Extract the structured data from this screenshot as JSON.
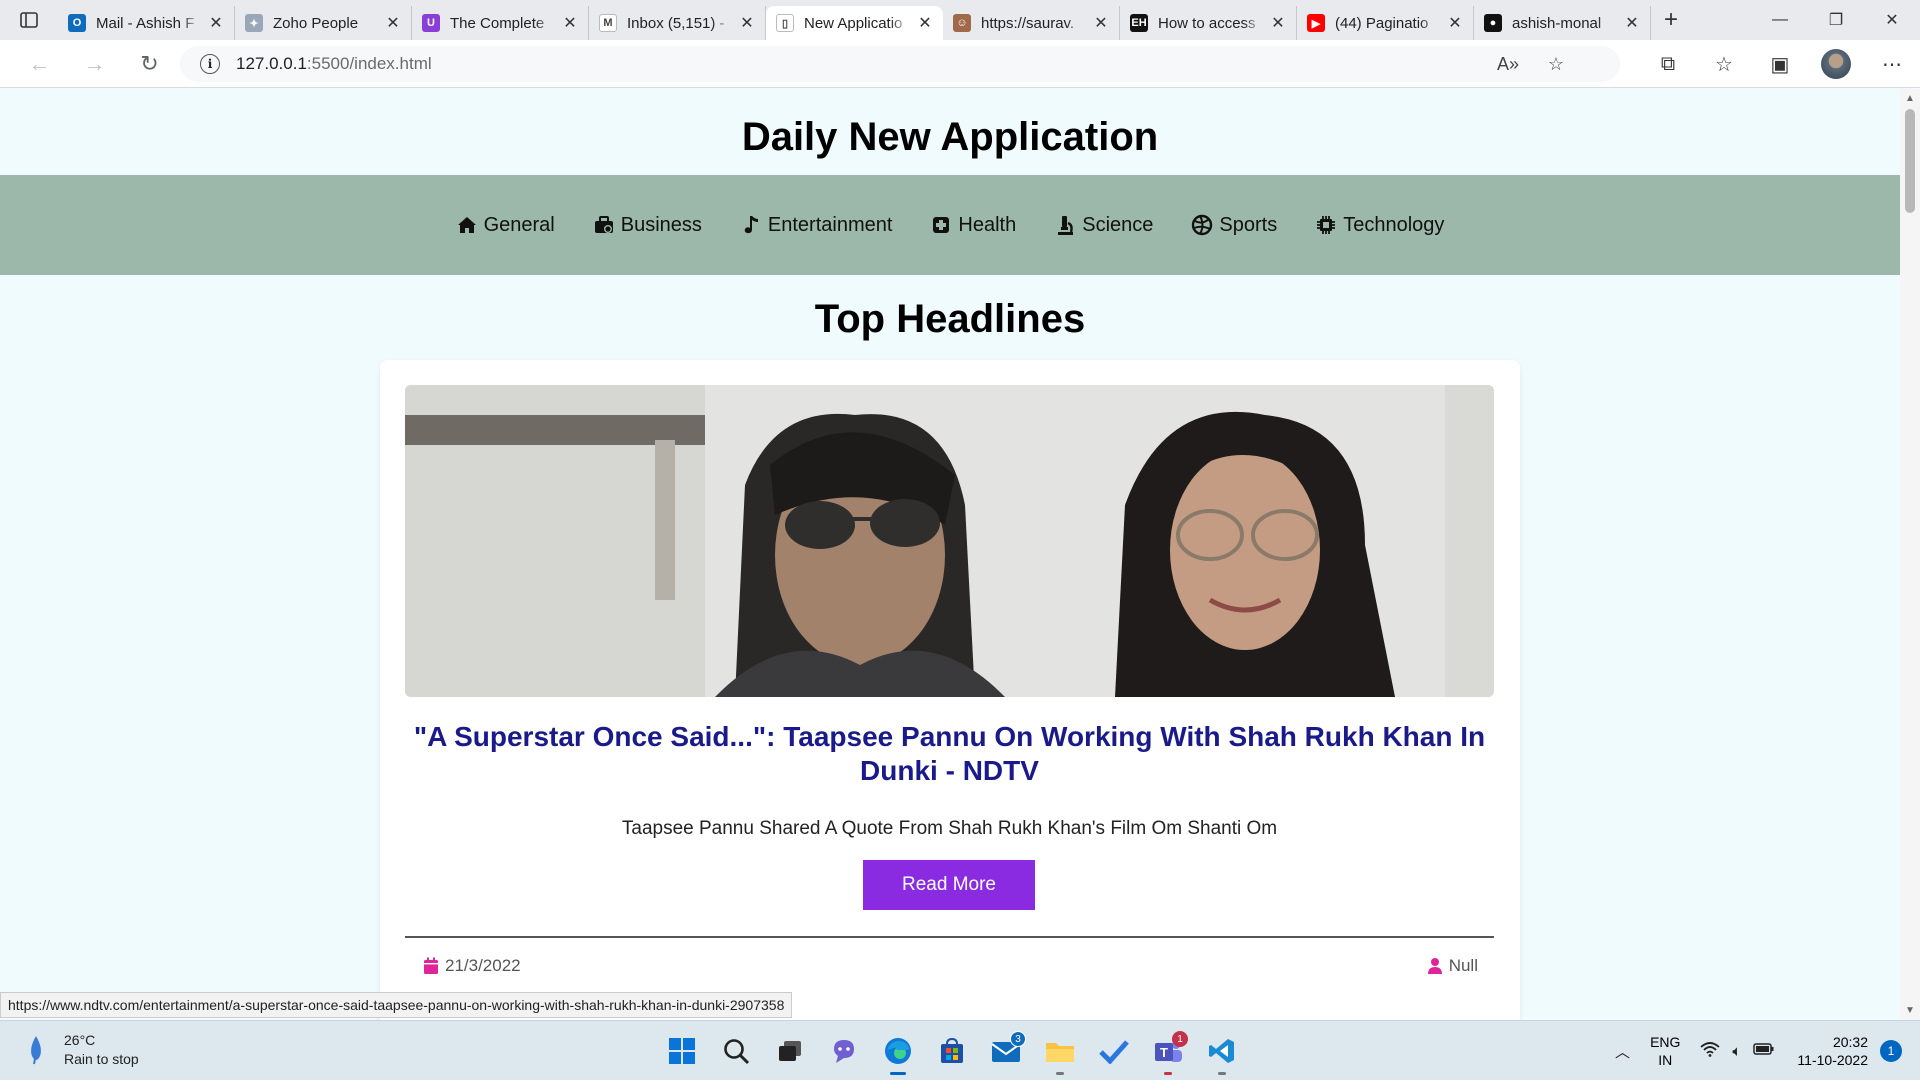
{
  "browser": {
    "tabs": [
      {
        "label": "Mail - Ashish F",
        "favicon_color": "#0f6cbd",
        "favicon_glyph": "O"
      },
      {
        "label": "Zoho People",
        "favicon_color": "#9aa7b8",
        "favicon_glyph": "✦"
      },
      {
        "label": "The Complete",
        "favicon_color": "#8b3fd9",
        "favicon_glyph": "U"
      },
      {
        "label": "Inbox (5,151) -",
        "favicon_color": "#ffffff",
        "favicon_glyph": "M"
      },
      {
        "label": "New Applicatio",
        "favicon_color": "#ffffff",
        "favicon_glyph": "▯"
      },
      {
        "label": "https://saurav.",
        "favicon_color": "#a06a4a",
        "favicon_glyph": "☺"
      },
      {
        "label": "How to access",
        "favicon_color": "#111111",
        "favicon_glyph": "EH"
      },
      {
        "label": "(44) Paginatio",
        "favicon_color": "#ff0000",
        "favicon_glyph": "▶"
      },
      {
        "label": "ashish-monal",
        "favicon_color": "#111111",
        "favicon_glyph": "●"
      }
    ],
    "active_tab_index": 4,
    "url_host": "127.0.0.1",
    "url_path": ":5500/index.html",
    "status_url": "https://www.ndtv.com/entertainment/a-superstar-once-said-taapsee-pannu-on-working-with-shah-rukh-khan-in-dunki-2907358"
  },
  "site": {
    "title": "Daily New Application",
    "section_title": "Top Headlines",
    "nav": [
      {
        "label": "General",
        "icon": "home-icon"
      },
      {
        "label": "Business",
        "icon": "business-icon"
      },
      {
        "label": "Entertainment",
        "icon": "music-note-icon"
      },
      {
        "label": "Health",
        "icon": "health-icon"
      },
      {
        "label": "Science",
        "icon": "microscope-icon"
      },
      {
        "label": "Sports",
        "icon": "ball-icon"
      },
      {
        "label": "Technology",
        "icon": "chip-icon"
      }
    ],
    "article": {
      "headline": "\"A Superstar Once Said...\": Taapsee Pannu On Working With Shah Rukh Khan In Dunki - NDTV",
      "description": "Taapsee Pannu Shared A Quote From Shah Rukh Khan's Film Om Shanti Om",
      "button": "Read More",
      "date": "21/3/2022",
      "author": "Null"
    },
    "colors": {
      "nav_bg": "#9cb8aa",
      "headline": "#1a1a8a",
      "button": "#8a2be2",
      "meta_icon": "#e0249a"
    }
  },
  "taskbar": {
    "temperature": "26°C",
    "weather_desc": "Rain to stop",
    "lang_line1": "ENG",
    "lang_line2": "IN",
    "time": "20:32",
    "date": "11-10-2022",
    "notifications": "1",
    "mail_badge": "3",
    "teams_badge": "1"
  }
}
